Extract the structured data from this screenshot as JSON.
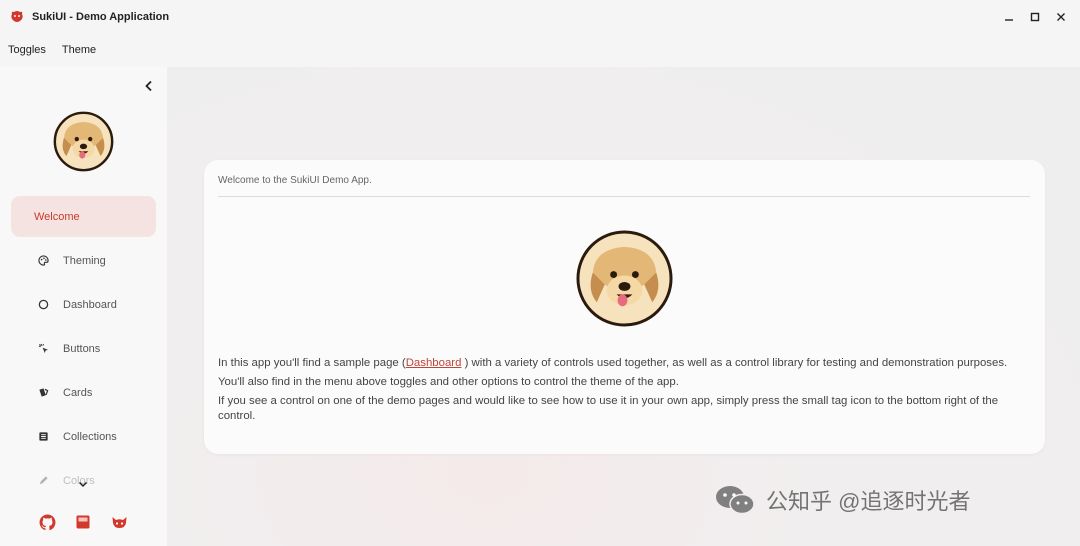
{
  "window": {
    "title": "SukiUI - Demo Application",
    "controls": {
      "minimize": "—",
      "maximize": "☐",
      "close": "✕"
    }
  },
  "menu": {
    "items": [
      "Toggles",
      "Theme"
    ]
  },
  "sidebar": {
    "collapse_icon": "chevron-left-icon",
    "items": [
      {
        "label": "Welcome",
        "icon": "none",
        "active": true
      },
      {
        "label": "Theming",
        "icon": "palette-icon",
        "active": false
      },
      {
        "label": "Dashboard",
        "icon": "circle-icon",
        "active": false
      },
      {
        "label": "Buttons",
        "icon": "cursor-click-icon",
        "active": false
      },
      {
        "label": "Cards",
        "icon": "cards-icon",
        "active": false
      },
      {
        "label": "Collections",
        "icon": "list-icon",
        "active": false
      },
      {
        "label": "Colors",
        "icon": "pencil-icon",
        "active": false
      }
    ],
    "footer_icons": [
      "github-icon",
      "book-icon",
      "cat-icon"
    ]
  },
  "colors": {
    "accent": "#c83a2e",
    "active_bg": "#f5e3e1"
  },
  "card": {
    "header": "Welcome to the SukiUI Demo App.",
    "para1_before": "In this app you'll find a sample page (",
    "para1_link": "Dashboard",
    "para1_after": " ) with a variety of controls used together, as well as a control library for testing and demonstration purposes.",
    "para2": "You'll also find in the menu above toggles and other options to control the theme of the app.",
    "para3": "If you see a control on one of the demo pages and would like to see how to use it in your own app, simply press the small tag icon to the bottom right of the control."
  },
  "watermark": {
    "text": "公知乎 @追逐时光者"
  }
}
